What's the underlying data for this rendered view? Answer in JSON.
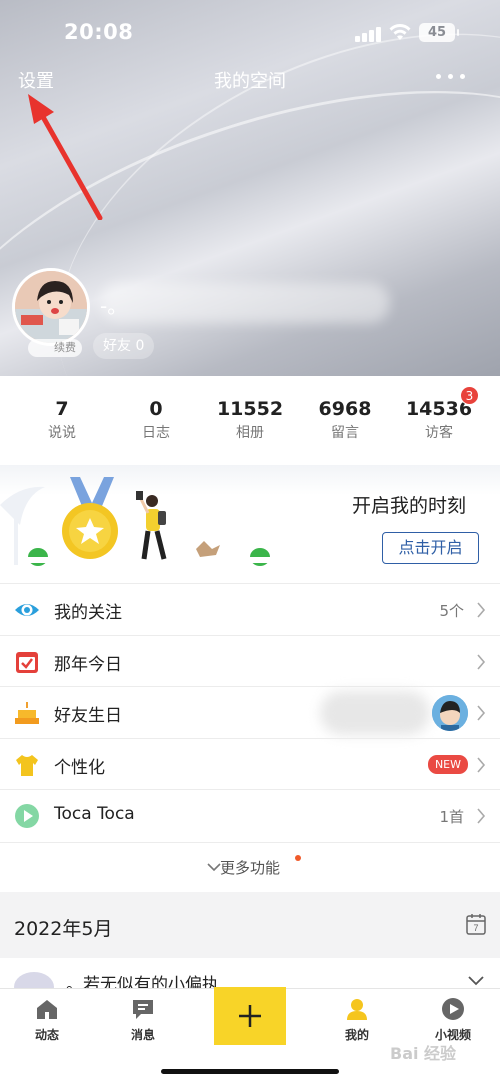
{
  "status_bar": {
    "time": "20:08",
    "battery": "45"
  },
  "nav": {
    "settings_label": "设置",
    "title": "我的空间"
  },
  "profile": {
    "renew_label": "续费",
    "friends_label": "好友 0",
    "nickname_prefix": "-。"
  },
  "stats": [
    {
      "num": "7",
      "label": "说说"
    },
    {
      "num": "0",
      "label": "日志"
    },
    {
      "num": "11552",
      "label": "相册"
    },
    {
      "num": "6968",
      "label": "留言"
    },
    {
      "num": "14536",
      "label": "访客"
    }
  ],
  "visitor_badge": "3",
  "banner": {
    "title": "开启我的时刻",
    "button": "点击开启"
  },
  "menu": [
    {
      "label": "我的关注",
      "value": "5个",
      "icon": "eye-icon"
    },
    {
      "label": "那年今日",
      "value": "",
      "icon": "calendar-check-icon"
    },
    {
      "label": "好友生日",
      "value": "",
      "icon": "cake-icon"
    },
    {
      "label": "个性化",
      "value": "NEW",
      "icon": "tshirt-icon"
    },
    {
      "label": "Toca Toca",
      "value": "1首",
      "icon": "play-icon"
    }
  ],
  "more_features": "更多功能",
  "month_header": {
    "label": "2022年5月",
    "calendar_day": "7"
  },
  "post_preview": "。若无似有的小偏执",
  "tabs": [
    {
      "label": "动态",
      "icon": "home-icon"
    },
    {
      "label": "消息",
      "icon": "message-icon"
    },
    {
      "label": "我的",
      "icon": "user-icon"
    },
    {
      "label": "小视频",
      "icon": "video-icon"
    }
  ],
  "watermark": "Bai 经验",
  "colors": {
    "accent_yellow": "#f8d428",
    "link_blue": "#2f5fa6",
    "badge_red": "#e8433c"
  }
}
